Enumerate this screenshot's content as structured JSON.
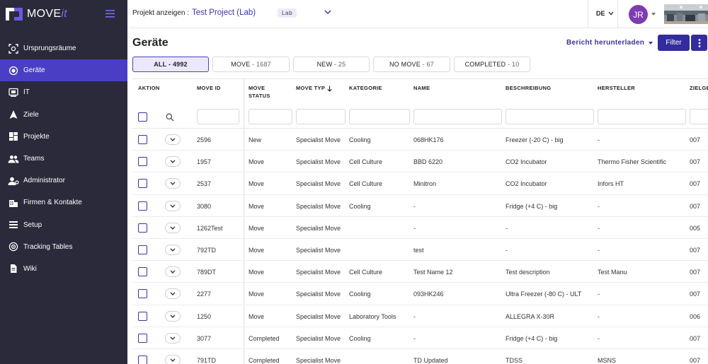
{
  "app": {
    "logo_text": "MOVE",
    "logo_suffix": "it"
  },
  "sidebar": {
    "items": [
      {
        "label": "Ursprungsräume",
        "icon": "scan-icon",
        "active": false
      },
      {
        "label": "Geräte",
        "icon": "devices-icon",
        "active": true
      },
      {
        "label": "IT",
        "icon": "computer-icon",
        "active": false
      },
      {
        "label": "Ziele",
        "icon": "navigation-arrow-icon",
        "active": false
      },
      {
        "label": "Projekte",
        "icon": "dashboard-icon",
        "active": false
      },
      {
        "label": "Teams",
        "icon": "group-icon",
        "active": false
      },
      {
        "label": "Administrator",
        "icon": "admin-user-icon",
        "active": false
      },
      {
        "label": "Firmen & Kontakte",
        "icon": "building-icon",
        "active": false
      },
      {
        "label": "Setup",
        "icon": "list-icon",
        "active": false
      },
      {
        "label": "Tracking Tables",
        "icon": "tracking-icon",
        "active": false
      },
      {
        "label": "Wiki",
        "icon": "document-icon",
        "active": false
      }
    ]
  },
  "topbar": {
    "project_label": "Projekt anzeigen :",
    "project_name": "Test Project (Lab)",
    "project_badge": "Lab",
    "language": "DE",
    "user_initials": "JR"
  },
  "page": {
    "title": "Geräte",
    "report_label": "Bericht herunterladen",
    "filter_label": "Filter"
  },
  "tabs": [
    {
      "label": "ALL",
      "count": "4992",
      "active": true
    },
    {
      "label": "MOVE",
      "count": "1687",
      "active": false
    },
    {
      "label": "NEW",
      "count": "25",
      "active": false
    },
    {
      "label": "NO MOVE",
      "count": "67",
      "active": false
    },
    {
      "label": "COMPLETED",
      "count": "10",
      "active": false
    }
  ],
  "table": {
    "headers": {
      "aktion": "AKTION",
      "move_id": "MOVE ID",
      "move_status_1": "MOVE",
      "move_status_2": "STATUS",
      "move_typ": "MOVE TYP",
      "kategorie": "KATEGORIE",
      "name": "NAME",
      "beschreibung": "BESCHREIBUNG",
      "hersteller": "HERSTELLER",
      "zielge": "ZIELGE"
    },
    "rows": [
      {
        "id": "2596",
        "status": "New",
        "typ": "Specialist Move",
        "kategorie": "Cooling",
        "name": "068HK176",
        "beschreibung": "Freezer (-20 C) - big",
        "hersteller": "-",
        "ziel": "007"
      },
      {
        "id": "1957",
        "status": "Move",
        "typ": "Specialist Move",
        "kategorie": "Cell Culture",
        "name": "BBD 6220",
        "beschreibung": "CO2 Incubator",
        "hersteller": "Thermo Fisher Scientific",
        "ziel": "007"
      },
      {
        "id": "2537",
        "status": "Move",
        "typ": "Specialist Move",
        "kategorie": "Cell Culture",
        "name": "Minitron",
        "beschreibung": "CO2 Incubator",
        "hersteller": "Infors HT",
        "ziel": "007"
      },
      {
        "id": "3080",
        "status": "Move",
        "typ": "Specialist Move",
        "kategorie": "Cooling",
        "name": "-",
        "beschreibung": "Fridge (+4 C) - big",
        "hersteller": "-",
        "ziel": "007"
      },
      {
        "id": "1262Test",
        "status": "Move",
        "typ": "Specialist Move",
        "kategorie": "",
        "name": "-",
        "beschreibung": "-",
        "hersteller": "-",
        "ziel": "005"
      },
      {
        "id": "792TD",
        "status": "Move",
        "typ": "Specialist Move",
        "kategorie": "",
        "name": "test",
        "beschreibung": "-",
        "hersteller": "-",
        "ziel": "007"
      },
      {
        "id": "789DT",
        "status": "Move",
        "typ": "Specialist Move",
        "kategorie": "Cell Culture",
        "name": "Test Name 12",
        "beschreibung": "Test description",
        "hersteller": "Test Manu",
        "ziel": "007"
      },
      {
        "id": "2277",
        "status": "Move",
        "typ": "Specialist Move",
        "kategorie": "Cooling",
        "name": "093HK246",
        "beschreibung": "Ultra Freezer (-80 C) - ULT",
        "hersteller": "-",
        "ziel": "007"
      },
      {
        "id": "1250",
        "status": "Move",
        "typ": "Specialist Move",
        "kategorie": "Laboratory Tools",
        "name": "-",
        "beschreibung": "ALLEGRA X-30R",
        "hersteller": "-",
        "ziel": "006"
      },
      {
        "id": "3077",
        "status": "Completed",
        "typ": "Specialist Move",
        "kategorie": "Cooling",
        "name": "-",
        "beschreibung": "Fridge (+4 C) - big",
        "hersteller": "-",
        "ziel": "007"
      },
      {
        "id": "791TD",
        "status": "Completed",
        "typ": "Specialist Move",
        "kategorie": "",
        "name": "TD Updated",
        "beschreibung": "TDSS",
        "hersteller": "MSNS",
        "ziel": "007"
      }
    ]
  }
}
